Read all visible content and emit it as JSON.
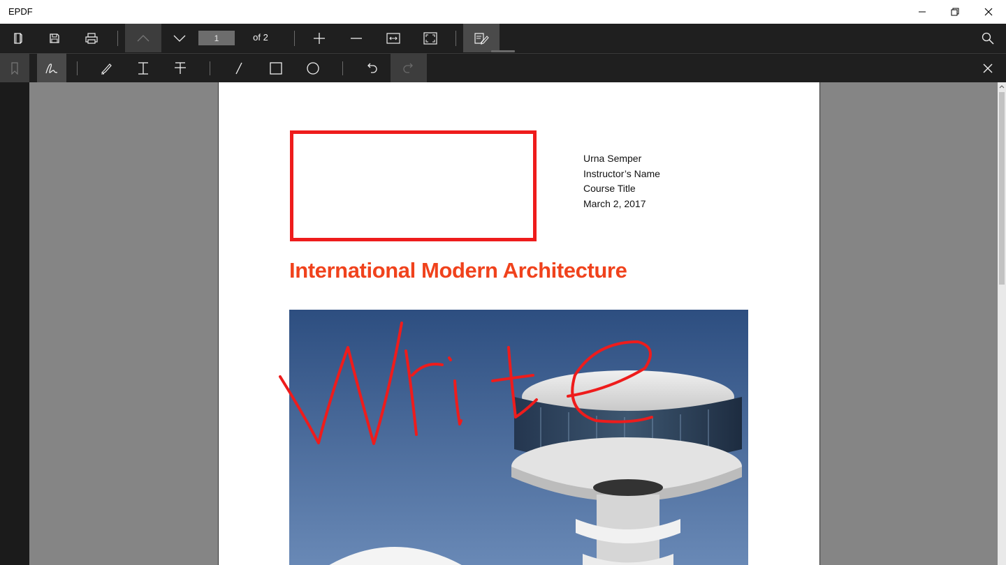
{
  "app": {
    "title": "EPDF"
  },
  "window": {
    "minimize_icon": "minimize-icon",
    "maximize_icon": "restore-icon",
    "close_icon": "close-icon"
  },
  "toolbar": {
    "page_current": "1",
    "page_total_label": "of 2",
    "icons": [
      "open-file-icon",
      "save-icon",
      "print-icon",
      "chevron-up-icon",
      "chevron-down-icon",
      "zoom-in-icon",
      "zoom-out-icon",
      "fit-width-icon",
      "fit-page-icon",
      "annotate-icon",
      "search-icon"
    ]
  },
  "annotation_toolbar": {
    "icons": [
      "bookmark-icon",
      "pen-icon",
      "highlighter-icon",
      "text-cursor-icon",
      "strikethrough-icon",
      "line-icon",
      "rectangle-icon",
      "ellipse-icon",
      "undo-icon",
      "redo-icon",
      "close-icon"
    ]
  },
  "document": {
    "meta": [
      "Urna Semper",
      "Instructor’s Name",
      "Course Title",
      "March 2, 2017"
    ],
    "title": "International Modern Architecture"
  },
  "colors": {
    "accent_red": "#ee1c1c",
    "title_orange": "#f0421c",
    "toolbar_bg": "#1f1f1f",
    "viewer_bg": "#858585"
  }
}
